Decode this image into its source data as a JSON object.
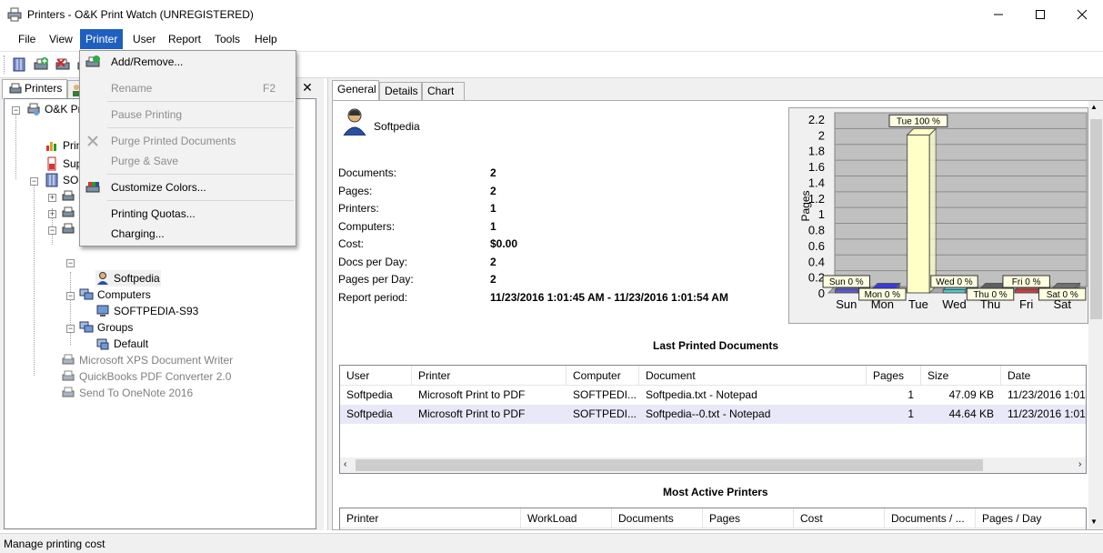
{
  "window": {
    "title": "Printers - O&K Print Watch (UNREGISTERED)"
  },
  "menubar": [
    "File",
    "View",
    "Printer",
    "User",
    "Report",
    "Tools",
    "Help"
  ],
  "printer_menu": {
    "items": [
      {
        "label": "Add/Remove...",
        "shortcut": "",
        "enabled": true
      },
      {
        "label": "Rename",
        "shortcut": "F2",
        "enabled": false
      },
      {
        "label": "Pause Printing",
        "shortcut": "",
        "enabled": false
      },
      {
        "label": "Purge Printed Documents",
        "shortcut": "",
        "enabled": false
      },
      {
        "label": "Purge & Save",
        "shortcut": "",
        "enabled": false
      },
      {
        "label": "Customize Colors...",
        "shortcut": "",
        "enabled": true
      },
      {
        "label": "Printing Quotas...",
        "shortcut": "",
        "enabled": true
      },
      {
        "label": "Charging...",
        "shortcut": "",
        "enabled": true
      }
    ]
  },
  "left_tabs": {
    "printers": "Printers"
  },
  "tree": {
    "root": "O&K Pr",
    "n1": "Prin",
    "n2": "Sup",
    "n3": "SOF",
    "user_softpedia": "Softpedia",
    "computers": "Computers",
    "computer_item": "SOFTPEDIA-S93",
    "groups": "Groups",
    "group_default": "Default",
    "printer_xps": "Microsoft XPS Document Writer",
    "printer_qb": "QuickBooks PDF Converter 2.0",
    "printer_onenote": "Send To OneNote 2016"
  },
  "right_tabs": [
    "General",
    "Details",
    "Chart"
  ],
  "user": {
    "name": "Softpedia"
  },
  "stats": [
    {
      "label": "Documents:",
      "value": "2"
    },
    {
      "label": "Pages:",
      "value": "2"
    },
    {
      "label": "Printers:",
      "value": "1"
    },
    {
      "label": "Computers:",
      "value": "1"
    },
    {
      "label": "Cost:",
      "value": "$0.00"
    },
    {
      "label": "Docs per Day:",
      "value": "2"
    },
    {
      "label": "Pages per Day:",
      "value": "2"
    },
    {
      "label": "Report period:",
      "value": "11/23/2016 1:01:45 AM - 11/23/2016 1:01:54 AM"
    }
  ],
  "chart_data": {
    "type": "bar",
    "ylabel": "Pages",
    "categories": [
      "Sun",
      "Mon",
      "Tue",
      "Wed",
      "Thu",
      "Fri",
      "Sat"
    ],
    "values": [
      0,
      0,
      2,
      0,
      0,
      0,
      0
    ],
    "labels": [
      "Sun 0 %",
      "Mon 0 %",
      "Tue 100 %",
      "Wed 0 %",
      "Thu 0 %",
      "Fri 0 %",
      "Sat 0 %"
    ],
    "yticks": [
      "0",
      "0.2",
      "0.4",
      "0.6",
      "0.8",
      "1",
      "1.2",
      "1.4",
      "1.6",
      "1.8",
      "2",
      "2.2"
    ],
    "ylim": [
      0,
      2.2
    ],
    "grid": true,
    "colors": [
      "#5b5bd6",
      "#3a3ae0",
      "#ffffc8",
      "#55c8c8",
      "#606060",
      "#c84040",
      "#707070"
    ]
  },
  "last_printed": {
    "title": "Last Printed Documents",
    "columns": [
      "User",
      "Printer",
      "Computer",
      "Document",
      "Pages",
      "Size",
      "Date"
    ],
    "rows": [
      [
        "Softpedia",
        "Microsoft Print to PDF",
        "SOFTPEDI...",
        "Softpedia.txt - Notepad",
        "1",
        "47.09 KB",
        "11/23/2016 1:01"
      ],
      [
        "Softpedia",
        "Microsoft Print to PDF",
        "SOFTPEDI...",
        "Softpedia--0.txt - Notepad",
        "1",
        "44.64 KB",
        "11/23/2016 1:01"
      ]
    ]
  },
  "most_active": {
    "title": "Most Active Printers",
    "columns": [
      "Printer",
      "WorkLoad",
      "Documents",
      "Pages",
      "Cost",
      "Documents / ...",
      "Pages / Day"
    ]
  },
  "status": {
    "text": "Manage printing cost"
  },
  "colors": {
    "menu_active": "#1f5fbf"
  }
}
